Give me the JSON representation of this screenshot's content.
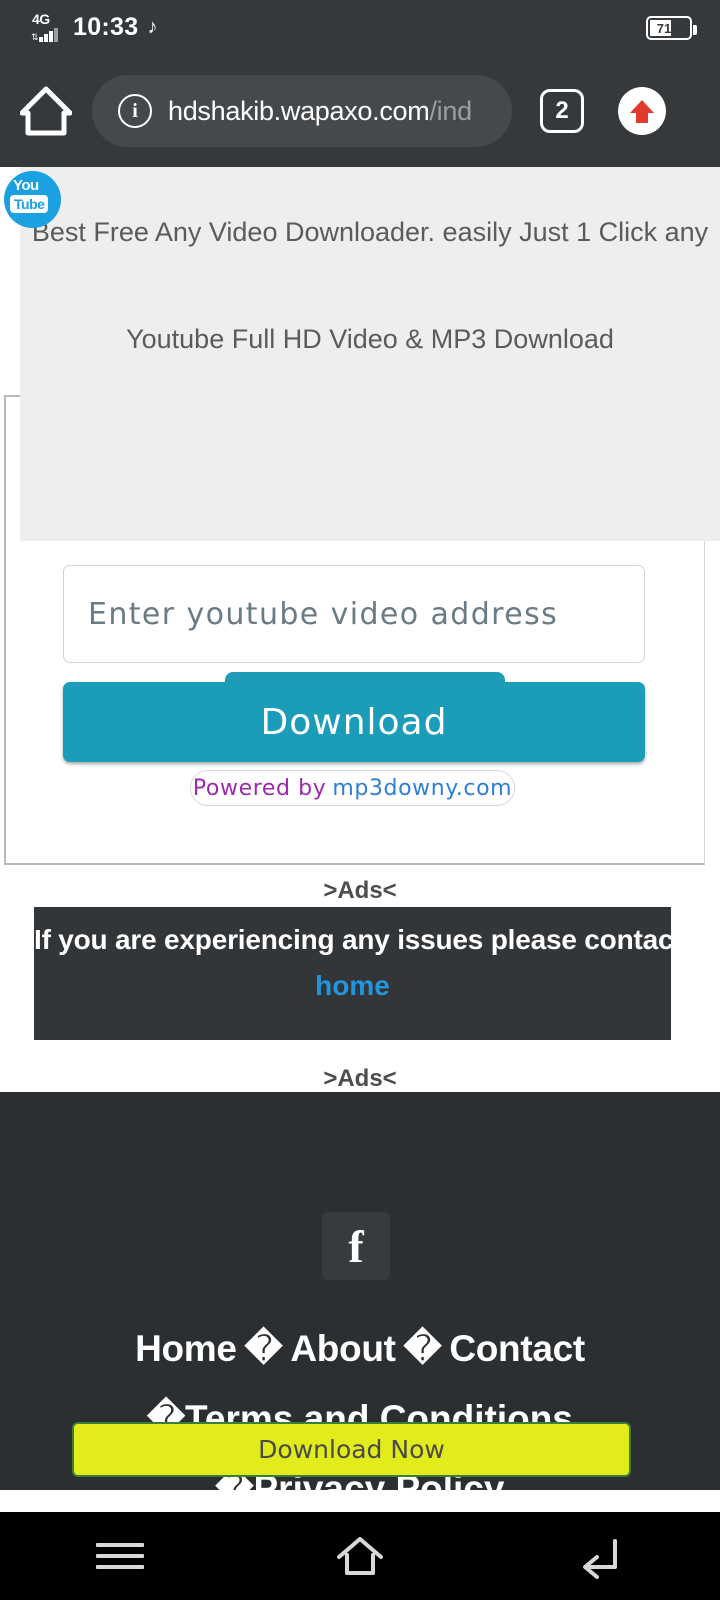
{
  "status_bar": {
    "network": "4G",
    "time": "10:33",
    "music_icon": "music-note-icon",
    "battery_level": "71"
  },
  "browser": {
    "home_icon": "home-icon",
    "security_icon": "info-icon",
    "url_visible": "hdshakib.wapaxo.com",
    "url_dim": "/ind",
    "tab_count": "2",
    "upload_icon": "up-arrow-icon"
  },
  "page": {
    "logo": {
      "line1": "You",
      "line2": "Tube"
    },
    "ad_overlay": {
      "line1": "Best Free Any Video Downloader. easily Just 1 Click any",
      "line2": "Youtube Full HD Video & MP3 Download"
    },
    "form": {
      "input_placeholder": "Enter youtube video address",
      "input_value": "",
      "download_button": "Download",
      "powered_prefix": "Powered by",
      "powered_site": "mp3downy.com"
    },
    "ads_label_1": ">Ads<",
    "ads_label_2": ">Ads<",
    "notice": {
      "text": "If you are experiencing any issues please contact",
      "link": "home"
    },
    "footer": {
      "facebook_icon": "facebook-icon",
      "link_home": "Home",
      "sep1": "�",
      "link_about": "About",
      "sep2": "�",
      "link_contact": "Contact",
      "sep3": "�",
      "link_terms": "Terms and Conditions",
      "sep4": "�",
      "link_privacy": "Privacy Policy"
    },
    "sticky_cta": "Download Now"
  },
  "navigation": {
    "recents_icon": "menu-icon",
    "home_icon": "home-outline-icon",
    "back_icon": "back-arrow-icon"
  },
  "colors": {
    "chrome": "#35393c",
    "accent_teal": "#1b9cb8",
    "cta_yellow": "#e1ec1a",
    "link_blue": "#2196dd",
    "footer_dark": "#2b2f31"
  }
}
